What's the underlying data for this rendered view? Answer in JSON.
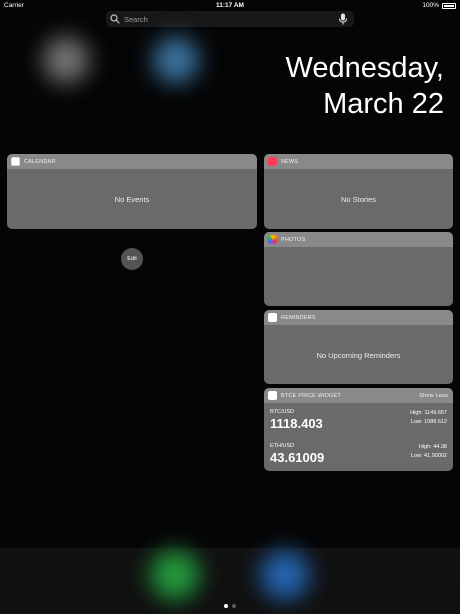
{
  "status_bar": {
    "carrier": "Carrier",
    "time": "11:17 AM",
    "battery": "100%"
  },
  "search": {
    "placeholder": "Search"
  },
  "date": {
    "weekday": "Wednesday,",
    "month_day": "March 22"
  },
  "widgets": {
    "calendar": {
      "title": "CALENDAR",
      "empty": "No Events"
    },
    "news": {
      "title": "NEWS",
      "empty": "No Stories"
    },
    "photos": {
      "title": "PHOTOS"
    },
    "reminders": {
      "title": "REMINDERS",
      "empty": "No Upcoming Reminders"
    },
    "btce": {
      "title": "BTCE PRICE WIDGET",
      "toggle": "Show Less",
      "pairs": [
        {
          "pair": "BTC/USD",
          "price": "1118.403",
          "high": "High: 1149.657",
          "low": "Low: 1088.612"
        },
        {
          "pair": "ETH/USD",
          "price": "43.61009",
          "high": "High: 44.38",
          "low": "Low: 41.90002"
        }
      ]
    }
  },
  "edit_label": "Edit",
  "page_dots": {
    "count": 2,
    "current": 1
  }
}
